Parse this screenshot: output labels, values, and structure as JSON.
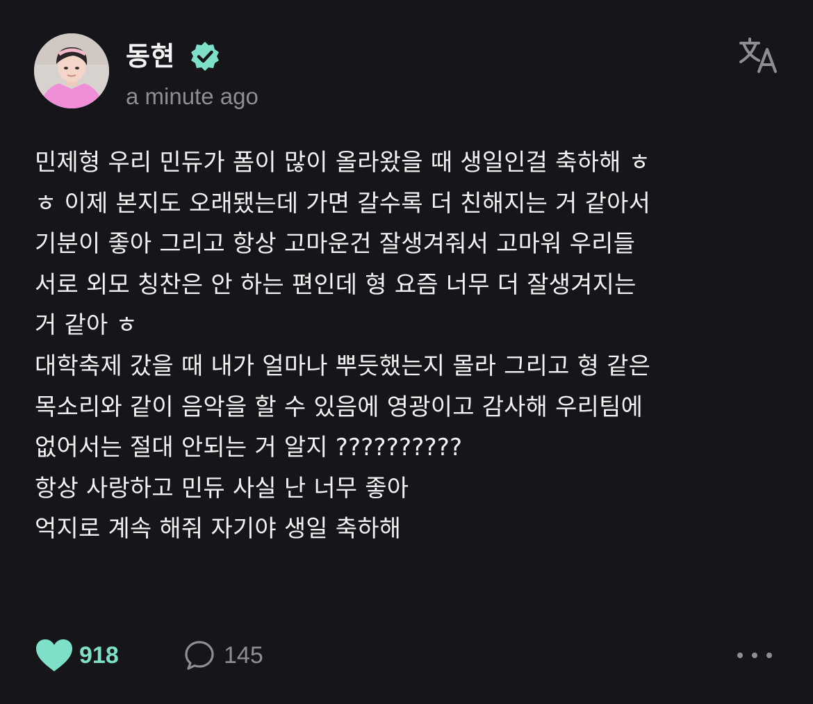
{
  "post": {
    "author": {
      "name": "동현",
      "verified": true,
      "badge_color": "#7ee0c8"
    },
    "timestamp": "a minute ago",
    "translate_icon": "translate-icon",
    "body": "민제형 우리 민듀가 폼이 많이 올라왔을 때 생일인걸 축하해 ㅎ\nㅎ 이제 본지도 오래됐는데 가면 갈수록 더 친해지는 거 같아서\n기분이 좋아 그리고 항상 고마운건 잘생겨줘서 고마워 우리들\n서로 외모 칭찬은 안 하는 편인데 형 요즘 너무 더 잘생겨지는\n거 같아 ㅎ\n대학축제 갔을 때 내가 얼마나 뿌듯했는지 몰라 그리고 형 같은\n목소리와 같이 음악을 할 수 있음에 영광이고 감사해 우리팀에\n없어서는 절대 안되는 거 알지 ??????????\n항상 사랑하고 민듀 사실 난 너무 좋아\n억지로 계속 해줘 자기야 생일 축하해",
    "actions": {
      "likes": "918",
      "comments": "145",
      "like_icon": "heart-icon",
      "comment_icon": "comment-bubble-icon",
      "more_icon": "more-dots-icon",
      "like_color": "#7ee0c8"
    }
  },
  "theme": {
    "background": "#16151a",
    "text": "#f2f2f4",
    "muted": "#8e8e95"
  }
}
